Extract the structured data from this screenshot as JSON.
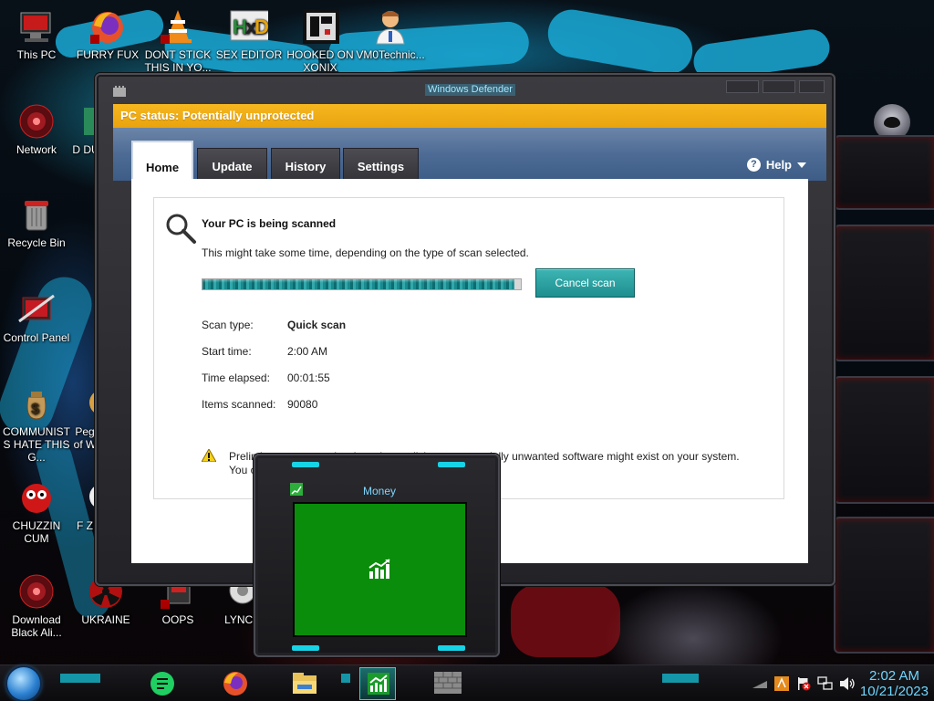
{
  "desktop_icons": [
    {
      "id": "this-pc",
      "label": "This PC"
    },
    {
      "id": "furry-fux",
      "label": "FURRY FUX"
    },
    {
      "id": "dont-stick",
      "label": "DONT STICK THIS IN YO..."
    },
    {
      "id": "sex-editor",
      "label": "SEX EDITOR"
    },
    {
      "id": "hooked-on-xonix",
      "label": "HOOKED ON XONIX"
    },
    {
      "id": "vm0technic",
      "label": "VM0Technic..."
    },
    {
      "id": "network",
      "label": "Network"
    },
    {
      "id": "recycle-bin",
      "label": "Recycle Bin"
    },
    {
      "id": "control-panel",
      "label": "Control Panel"
    },
    {
      "id": "communists",
      "label": "COMMUNISTS HATE THIS G..."
    },
    {
      "id": "chuzzin",
      "label": "CHUZZIN CUM"
    },
    {
      "id": "download-black",
      "label": "Download Black Ali..."
    },
    {
      "id": "ukraine",
      "label": "UKRAINE"
    },
    {
      "id": "oops",
      "label": "OOPS"
    },
    {
      "id": "lynch",
      "label": "LYNCH"
    },
    {
      "id": "partial-d",
      "label": "D DU"
    },
    {
      "id": "partial-peg",
      "label": "Peg of W"
    },
    {
      "id": "partial-f",
      "label": "F Z"
    }
  ],
  "defender": {
    "window_title": "Windows Defender",
    "status": "PC status: Potentially unprotected",
    "tabs": [
      {
        "label": "Home",
        "active": true
      },
      {
        "label": "Update",
        "active": false
      },
      {
        "label": "History",
        "active": false
      },
      {
        "label": "Settings",
        "active": false
      }
    ],
    "help_label": "Help",
    "scan": {
      "title": "Your PC is being scanned",
      "description": "This might take some time, depending on the type of scan selected.",
      "progress": 0.98,
      "cancel_label": "Cancel scan",
      "details": [
        {
          "key": "Scan type:",
          "value": "Quick scan",
          "bold": true
        },
        {
          "key": "Start time:",
          "value": "2:00 AM",
          "bold": false
        },
        {
          "key": "Time elapsed:",
          "value": "00:01:55",
          "bold": false
        },
        {
          "key": "Items scanned:",
          "value": "90080",
          "bold": false
        }
      ],
      "warning_line1": "Preliminary scan results show that malicious or potentially unwanted software might exist on your system.",
      "warning_line2": "You can continue the scan until all items are detected."
    }
  },
  "money_widget": {
    "title": "Money"
  },
  "taskbar": {
    "clock_time": "2:02 AM",
    "clock_date": "10/21/2023"
  },
  "colors": {
    "status_bar": "#f0ad18",
    "tab_strip": "#4d6b95",
    "accent_cyan": "#17d3e6",
    "money_tile": "#0a8d0a",
    "cancel_button": "#2aa0a0"
  }
}
